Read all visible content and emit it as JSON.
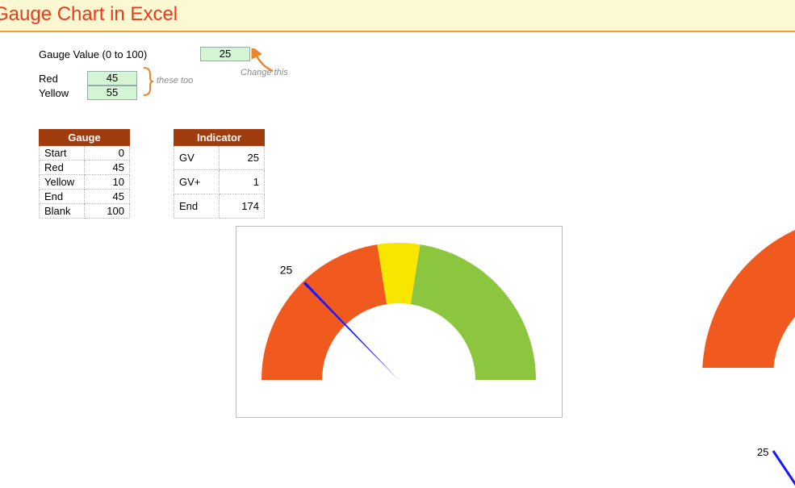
{
  "title": "Gauge Chart in Excel",
  "inputs": {
    "gauge_value_label": "Gauge Value (0 to 100)",
    "gauge_value": "25",
    "red_label": "Red",
    "red_value": "45",
    "yellow_label": "Yellow",
    "yellow_value": "55",
    "change_this": "Change this",
    "these_too": "these too"
  },
  "gauge_table": {
    "header": "Gauge",
    "rows": [
      {
        "k": "Start",
        "v": "0"
      },
      {
        "k": "Red",
        "v": "45"
      },
      {
        "k": "Yellow",
        "v": "10"
      },
      {
        "k": "End",
        "v": "45"
      },
      {
        "k": "Blank",
        "v": "100"
      }
    ]
  },
  "indicator_table": {
    "header": "Indicator",
    "rows": [
      {
        "k": "GV",
        "v": "25"
      },
      {
        "k": "GV+",
        "v": "1"
      },
      {
        "k": "End",
        "v": "174"
      }
    ]
  },
  "needle_label": "25",
  "partial_needle_label": "25",
  "chart_data": {
    "type": "pie",
    "title": "Gauge Chart",
    "gauge_segments": [
      {
        "name": "Start",
        "value": 0,
        "color": null
      },
      {
        "name": "Red",
        "value": 45,
        "color": "#f05a1e"
      },
      {
        "name": "Yellow",
        "value": 10,
        "color": "#f7e600"
      },
      {
        "name": "End",
        "value": 45,
        "color": "#8cc63f"
      },
      {
        "name": "Blank",
        "value": 100,
        "color": null
      }
    ],
    "indicator": {
      "gv": 25,
      "gv_plus": 1,
      "end": 174,
      "needle_color": "#1a1aff"
    },
    "range": [
      0,
      100
    ]
  }
}
